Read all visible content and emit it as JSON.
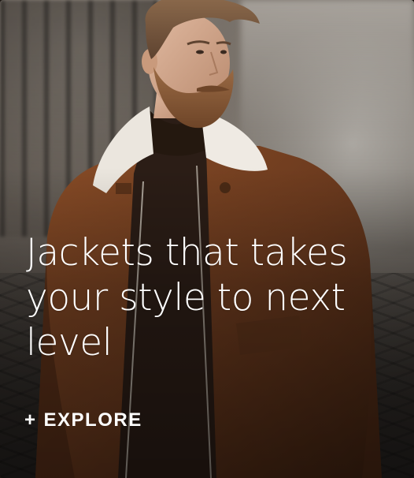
{
  "card": {
    "headline": "Jackets that takes your style to next level",
    "cta": {
      "icon": "plus-icon",
      "icon_glyph": "+",
      "label": "EXPLORE"
    }
  },
  "colors": {
    "text": "#ffffff",
    "jacket": "#6b3a1e",
    "collar": "#e8e4dc"
  }
}
